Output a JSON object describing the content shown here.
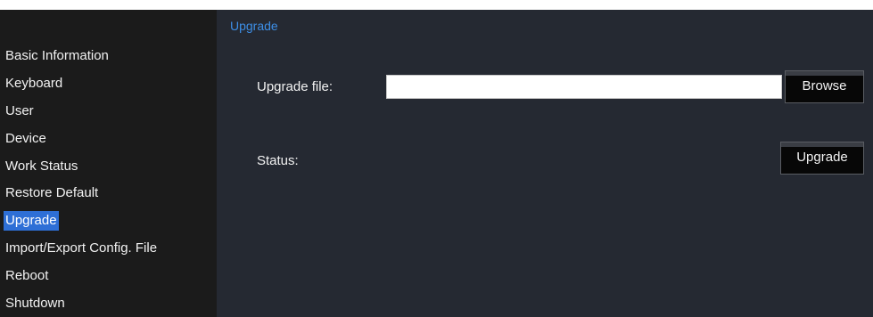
{
  "sidebar": {
    "items": [
      {
        "label": "Basic Information"
      },
      {
        "label": "Keyboard"
      },
      {
        "label": "User"
      },
      {
        "label": "Device"
      },
      {
        "label": "Work Status"
      },
      {
        "label": "Restore Default"
      },
      {
        "label": "Upgrade",
        "active": true
      },
      {
        "label": "Import/Export Config. File"
      },
      {
        "label": "Reboot"
      },
      {
        "label": "Shutdown"
      }
    ]
  },
  "main": {
    "title": "Upgrade",
    "upgrade_file": {
      "label": "Upgrade file:",
      "value": "",
      "browse_label": "Browse"
    },
    "status": {
      "label": "Status:",
      "upgrade_label": "Upgrade"
    }
  },
  "colors": {
    "sidebar_bg": "#1b1b1b",
    "main_bg": "#252932",
    "accent": "#2e6fd6",
    "title_text": "#3d8ee6"
  }
}
